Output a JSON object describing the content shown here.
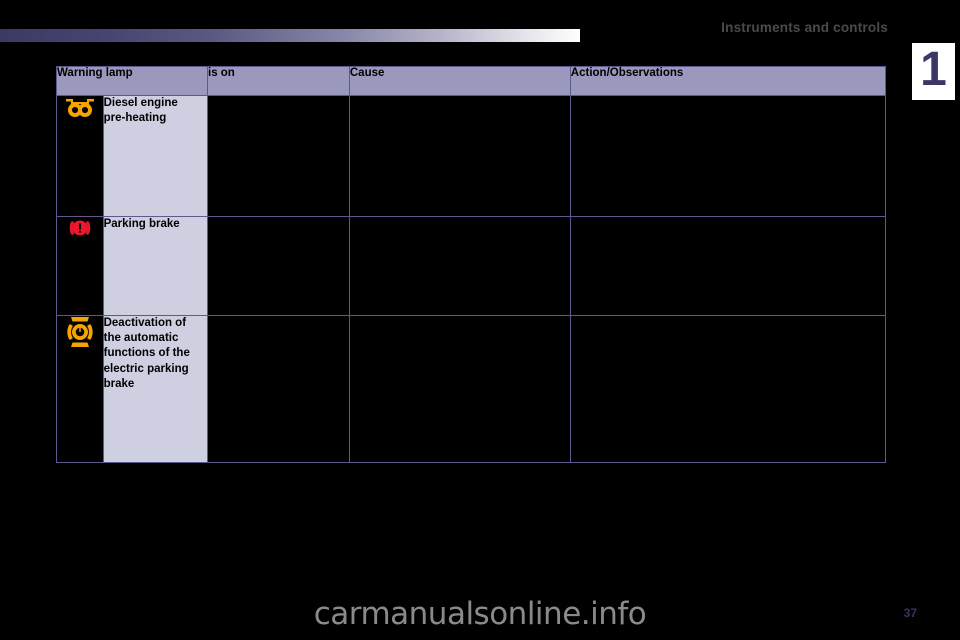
{
  "header": {
    "title": "Instruments and controls",
    "chapter_number": "1"
  },
  "table": {
    "columns": [
      {
        "key": "lamp",
        "label": "Warning lamp"
      },
      {
        "key": "is_on",
        "label": "is on"
      },
      {
        "key": "cause",
        "label": "Cause"
      },
      {
        "key": "action",
        "label": "Action/Observations"
      }
    ],
    "rows": [
      {
        "icon": "diesel-preheating-glowplug-icon",
        "icon_color": "#F5A400",
        "lamp": "Diesel engine\npre-heating",
        "lamp_line_1": "Diesel engine",
        "lamp_line_2": "pre-heating",
        "is_on": "",
        "cause": "",
        "action": ""
      },
      {
        "icon": "parking-brake-icon",
        "icon_color": "#E8192C",
        "lamp": "Parking brake",
        "lamp_line_1": "Parking brake",
        "lamp_line_2": "",
        "is_on": "",
        "cause": "",
        "action": ""
      },
      {
        "icon": "electric-parking-brake-auto-off-icon",
        "icon_color": "#F5A400",
        "lamp": "Deactivation of the automatic functions of the electric parking brake",
        "lamp_line_1": "Deactivation of",
        "lamp_line_2": "the automatic",
        "lamp_line_3": "functions of the",
        "lamp_line_4": "electric parking",
        "lamp_line_5": "brake",
        "is_on": "",
        "cause": "",
        "action": ""
      }
    ]
  },
  "footer": {
    "watermark": "carmanualsonline.info",
    "page_number": "37"
  },
  "colors": {
    "header_row_bg": "#9a99bd",
    "name_cell_bg": "#ced0e2",
    "border": "#5c5a8c",
    "accent_dark": "#3b3866",
    "page_bg": "#000000"
  }
}
